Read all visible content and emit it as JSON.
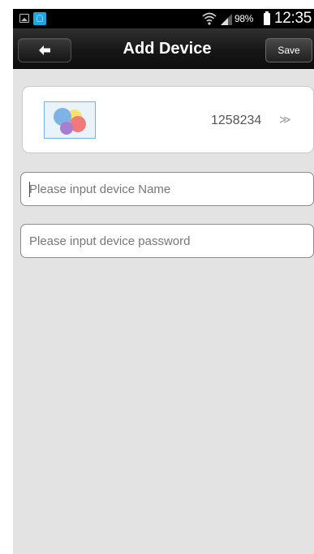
{
  "status_bar": {
    "battery_percent": "98%",
    "time": "12:35",
    "icons": [
      "image-notification-icon",
      "app-notification-icon",
      "wifi-icon",
      "signal-icon",
      "battery-icon"
    ]
  },
  "header": {
    "back_icon": "back-arrow-icon",
    "title": "Add Device",
    "save_label": "Save"
  },
  "device": {
    "icon": "device-color-circles-icon",
    "id": "1258234",
    "chevron": "≫",
    "icon_colors": [
      "#f8e36a",
      "#7fb3e6",
      "#f07a7a",
      "#a77fd0"
    ]
  },
  "form": {
    "name_placeholder": "Please input device Name",
    "password_placeholder": "Please input device password"
  },
  "colors": {
    "background": "#e3e3e3",
    "title_bar": "#1a1a1a",
    "status_bar": "#000000",
    "accent_blue": "#1fa6e0"
  }
}
